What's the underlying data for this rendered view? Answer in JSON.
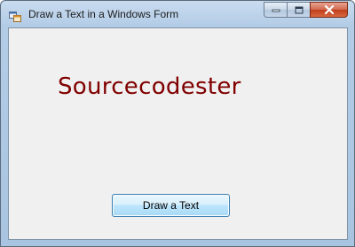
{
  "window": {
    "title": "Draw a Text in a Windows Form",
    "icon": "winforms-app-icon",
    "caption_buttons": [
      "minimize-icon",
      "maximize-icon",
      "close-icon"
    ]
  },
  "canvas": {
    "drawn_text": "Sourcecodester",
    "drawn_text_color": "#800000"
  },
  "button": {
    "label": "Draw a Text"
  }
}
